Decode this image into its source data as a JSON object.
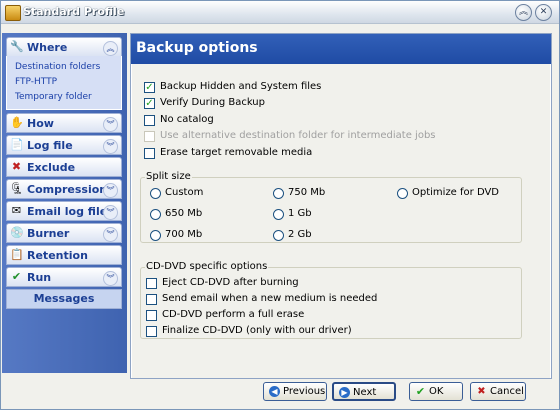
{
  "window": {
    "title": "Standard Profile",
    "min_icon": "chevron-up-icon",
    "close_icon": "close-icon"
  },
  "sidebar": {
    "groups": [
      {
        "label": "Where",
        "icon": "wrench-icon",
        "chevron": "chevron-up-icon",
        "expanded": true,
        "items": [
          "Destination folders",
          "FTP-HTTP",
          "Temporary folder"
        ]
      },
      {
        "label": "How",
        "icon": "hand-icon",
        "chevron": "chevron-down-icon"
      },
      {
        "label": "Log file",
        "icon": "document-icon",
        "chevron": "chevron-down-icon"
      },
      {
        "label": "Exclude",
        "icon": "x-icon"
      },
      {
        "label": "Compression",
        "icon": "compress-icon",
        "chevron": "chevron-down-icon"
      },
      {
        "label": "Email log file",
        "icon": "envelope-icon",
        "chevron": "chevron-down-icon"
      },
      {
        "label": "Burner",
        "icon": "burner-icon",
        "chevron": "chevron-down-icon"
      },
      {
        "label": "Retention",
        "icon": "retention-icon"
      },
      {
        "label": "Run",
        "icon": "check-icon",
        "chevron": "chevron-down-icon"
      }
    ],
    "messages_label": "Messages"
  },
  "main": {
    "title": "Backup options",
    "options": [
      {
        "label": "Backup Hidden and System files",
        "checked": true,
        "enabled": true
      },
      {
        "label": "Verify During Backup",
        "checked": true,
        "enabled": true
      },
      {
        "label": "No catalog",
        "checked": false,
        "enabled": true
      },
      {
        "label": "Use alternative destination folder for intermediate jobs",
        "checked": false,
        "enabled": false
      },
      {
        "label": "Erase target removable media",
        "checked": false,
        "enabled": true
      }
    ],
    "split": {
      "title": "Split size",
      "options": [
        "Custom",
        "750 Mb",
        "Optimize for DVD",
        "650 Mb",
        "1 Gb",
        "700 Mb",
        "2 Gb"
      ]
    },
    "cddvd": {
      "title": "CD-DVD specific options",
      "options": [
        {
          "label": "Eject CD-DVD after burning",
          "checked": false
        },
        {
          "label": "Send email when a new medium is needed",
          "checked": false
        },
        {
          "label": "CD-DVD perform a full erase",
          "checked": false
        },
        {
          "label": "Finalize CD-DVD (only with our driver)",
          "checked": false
        }
      ]
    }
  },
  "buttons": {
    "previous": "Previous",
    "next": "Next",
    "ok": "OK",
    "cancel": "Cancel"
  },
  "colors": {
    "header_blue": "#2555b0",
    "sidebar_blue": "#4a6fbf",
    "check_green": "#21a121"
  }
}
